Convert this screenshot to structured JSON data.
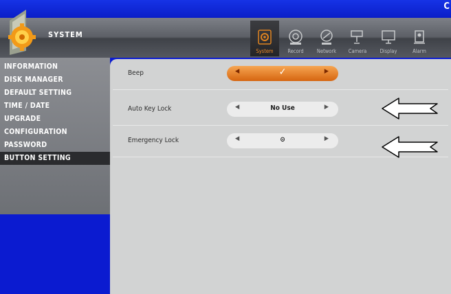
{
  "window": {
    "corner_text": "C"
  },
  "header": {
    "title": "SYSTEM"
  },
  "tabs": [
    {
      "label": "System",
      "icon": "gear-icon",
      "active": true
    },
    {
      "label": "Record",
      "icon": "record-icon"
    },
    {
      "label": "Network",
      "icon": "network-icon"
    },
    {
      "label": "Camera",
      "icon": "camera-icon"
    },
    {
      "label": "Display",
      "icon": "display-icon"
    },
    {
      "label": "Alarm",
      "icon": "alarm-icon"
    }
  ],
  "sidebar": {
    "items": [
      {
        "label": "INFORMATION"
      },
      {
        "label": "DISK MANAGER"
      },
      {
        "label": "DEFAULT SETTING"
      },
      {
        "label": "TIME / DATE"
      },
      {
        "label": "UPGRADE"
      },
      {
        "label": "CONFIGURATION"
      },
      {
        "label": "PASSWORD"
      },
      {
        "label": "BUTTON SETTING",
        "active": true
      }
    ]
  },
  "settings": [
    {
      "label": "Beep",
      "value": "✓",
      "active": true
    },
    {
      "label": "Auto Key Lock",
      "value": "No Use"
    },
    {
      "label": "Emergency Lock",
      "value": "⊝"
    }
  ],
  "colors": {
    "accent": "#f08a28",
    "frame": "#0b1bd0",
    "panel": "#d2d3d3"
  }
}
